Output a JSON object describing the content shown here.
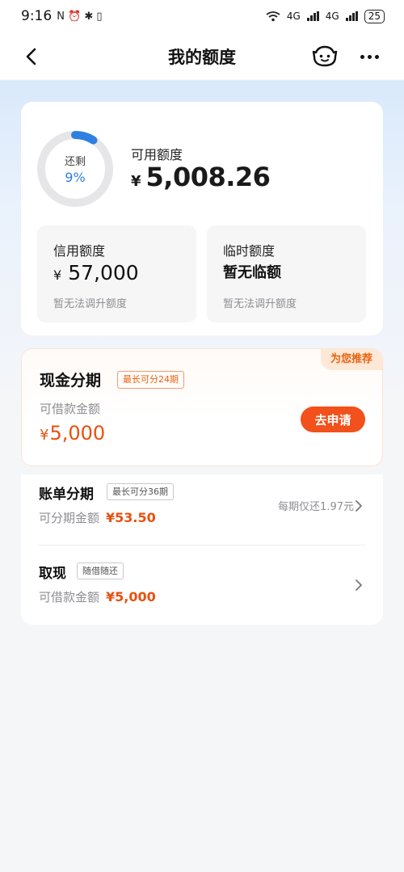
{
  "status_bar": {
    "time": "9:16",
    "left_icons": "N ⏰ ✱ ▯",
    "network_1": "4G",
    "network_2": "4G",
    "battery": "25"
  },
  "nav": {
    "title": "我的额度"
  },
  "quota": {
    "ring_label": "还剩",
    "ring_value": "9%",
    "ring_fraction": 0.09,
    "available_label": "可用额度",
    "currency": "¥",
    "available_amount": "5,008.26",
    "credit": {
      "label": "信用额度",
      "currency": "¥",
      "value": "57,000",
      "note": "暂无法调升额度"
    },
    "temporary": {
      "label": "临时额度",
      "value": "暂无临额",
      "note": "暂无法调升额度"
    }
  },
  "cash_installment": {
    "recommend_tag": "为您推荐",
    "title": "现金分期",
    "tag": "最长可分24期",
    "sub_label": "可借款金额",
    "currency": "¥",
    "amount": "5,000",
    "apply_button": "去申请"
  },
  "bill_installment": {
    "title": "账单分期",
    "tag": "最长可分36期",
    "sub_label": "可分期金额",
    "amount": "¥53.50",
    "note": "每期仅还1.97元"
  },
  "cash_withdraw": {
    "title": "取现",
    "tag": "随借随还",
    "sub_label": "可借款金额",
    "amount": "¥5,000"
  },
  "colors": {
    "accent_blue": "#2f7fe0",
    "accent_orange": "#e8500f",
    "apply_button": "#f2511b"
  }
}
